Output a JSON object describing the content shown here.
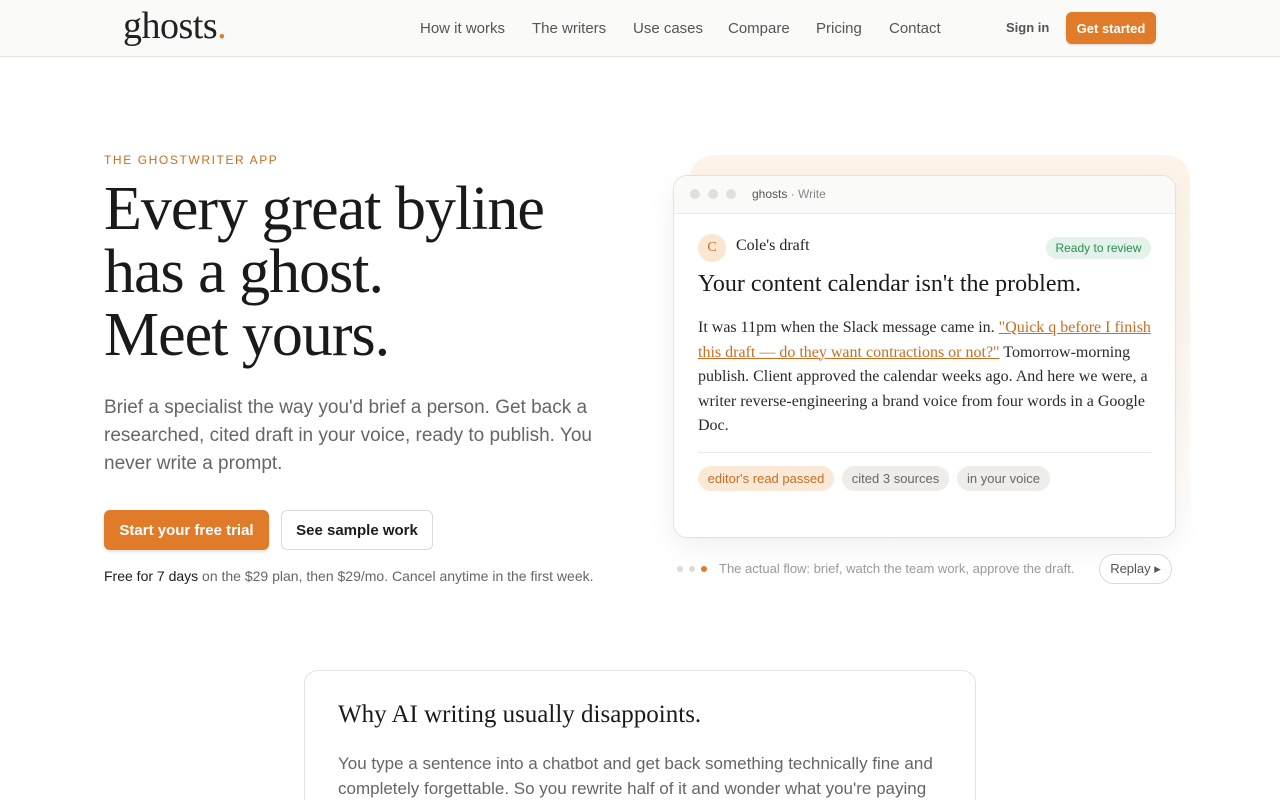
{
  "header": {
    "logo_text": "ghosts",
    "logo_dot": ".",
    "nav": [
      "How it works",
      "The writers",
      "Use cases",
      "Compare",
      "Pricing",
      "Contact"
    ],
    "signin": "Sign in",
    "cta": "Get started"
  },
  "hero": {
    "eyebrow": "THE GHOSTWRITER APP",
    "headline": [
      "Every great byline",
      "has a ghost.",
      "Meet yours."
    ],
    "subtext": "Brief a specialist the way you'd brief a person. Get back a researched, cited draft in your voice, ready to publish. You never write a prompt.",
    "primary_button": "Start your free trial",
    "secondary_button": "See sample work",
    "trial_bold": "Free for 7 days",
    "trial_rest": " on the $29 plan, then $29/mo. Cancel anytime in the first week."
  },
  "preview": {
    "bar_app": "ghosts",
    "bar_sep": " · Write",
    "avatar_initial": "C",
    "draft_owner": "Cole's draft",
    "status_badge": "Ready to review",
    "title": "Your content calendar isn't the problem.",
    "body_before": "It was 11pm when the Slack message came in. ",
    "body_quote": "\"Quick q before I finish this draft — do they want contractions or not?\"",
    "body_after": " Tomorrow-morning publish. Client approved the calendar weeks ago. And here we were, a writer reverse-engineering a brand voice from four words in a Google Doc.",
    "chips": [
      "editor's read passed",
      "cited 3 sources",
      "in your voice"
    ],
    "flow_caption": "The actual flow: brief, watch the team work, approve the draft.",
    "replay": "Replay ▸"
  },
  "why": {
    "title": "Why AI writing usually disappoints.",
    "text": "You type a sentence into a chatbot and get back something technically fine and completely forgettable. So you rewrite half of it and wonder what you're paying"
  },
  "colors": {
    "accent": "#e07b2a",
    "accent_text": "#c86e23",
    "success_bg": "#e3f3ea",
    "success_text": "#2f8a55"
  }
}
